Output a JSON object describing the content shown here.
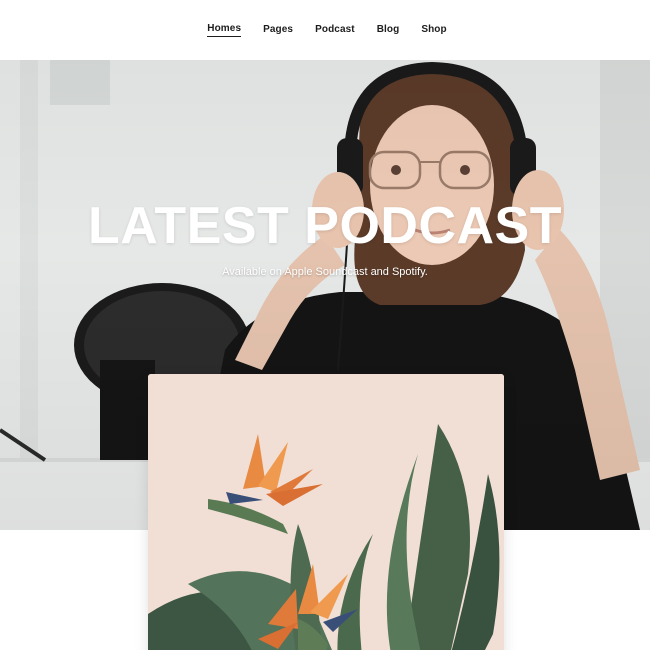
{
  "nav": {
    "items": [
      {
        "label": "Homes",
        "active": true
      },
      {
        "label": "Pages",
        "active": false
      },
      {
        "label": "Podcast",
        "active": false
      },
      {
        "label": "Blog",
        "active": false
      },
      {
        "label": "Shop",
        "active": false
      }
    ]
  },
  "hero": {
    "title": "LATEST PODCAST",
    "subtitle": "Available on Apple Soundcast and Spotify.",
    "image_icon": "person-with-headphones-photo"
  },
  "feature": {
    "image_icon": "bird-of-paradise-plant-photo"
  },
  "colors": {
    "background": "#ffffff",
    "nav_text": "#1d1d1d",
    "hero_text": "#ffffff",
    "card_background": "#f0ddd3",
    "leaf_green": "#3f5a44",
    "flower_orange": "#e07a3a"
  }
}
